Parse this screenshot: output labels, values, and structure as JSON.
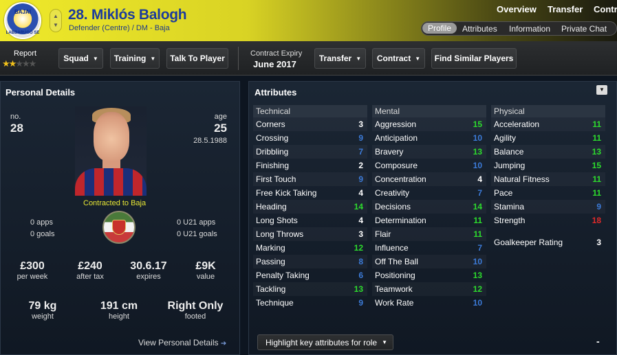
{
  "header": {
    "club_logo_text": [
      "BAJAI",
      "LABDARÚGÓ SE"
    ],
    "player_name": "28. Miklós Balogh",
    "player_role": "Defender (Centre) / DM - Baja",
    "topnav": [
      "Overview",
      "Transfer",
      "Contr"
    ],
    "subnav": [
      "Profile",
      "Attributes",
      "Information",
      "Private Chat"
    ],
    "subnav_active": "Profile"
  },
  "toolbar": {
    "report_label": "Report",
    "report_stars": 2,
    "report_stars_max": 5,
    "squad": "Squad",
    "training": "Training",
    "talk": "Talk To Player",
    "expiry_label": "Contract Expiry",
    "expiry_value": "June 2017",
    "transfer": "Transfer",
    "contract": "Contract",
    "find_similar": "Find Similar Players"
  },
  "personal": {
    "title": "Personal Details",
    "no_label": "no.",
    "no": "28",
    "age_label": "age",
    "age": "25",
    "dob": "28.5.1988",
    "contracted": "Contracted to Baja",
    "apps": "0 apps",
    "goals": "0 goals",
    "u21_apps": "0 U21 apps",
    "u21_goals": "0 U21 goals",
    "wage": "£300",
    "wage_label": "per week",
    "after_tax": "£240",
    "after_tax_label": "after tax",
    "expires": "30.6.17",
    "expires_label": "expires",
    "value": "£9K",
    "value_label": "value",
    "weight": "79 kg",
    "weight_label": "weight",
    "height": "191 cm",
    "height_label": "height",
    "footed": "Right Only",
    "footed_label": "footed",
    "view_link": "View Personal Details"
  },
  "attributes": {
    "title": "Attributes",
    "technical": {
      "label": "Technical",
      "items": [
        {
          "name": "Corners",
          "value": "3",
          "color": "#ffffff"
        },
        {
          "name": "Crossing",
          "value": "9",
          "color": "#3c7bd8"
        },
        {
          "name": "Dribbling",
          "value": "7",
          "color": "#3c7bd8"
        },
        {
          "name": "Finishing",
          "value": "2",
          "color": "#ffffff"
        },
        {
          "name": "First Touch",
          "value": "9",
          "color": "#3c7bd8"
        },
        {
          "name": "Free Kick Taking",
          "value": "4",
          "color": "#ffffff"
        },
        {
          "name": "Heading",
          "value": "14",
          "color": "#2ddc2d"
        },
        {
          "name": "Long Shots",
          "value": "4",
          "color": "#ffffff"
        },
        {
          "name": "Long Throws",
          "value": "3",
          "color": "#ffffff"
        },
        {
          "name": "Marking",
          "value": "12",
          "color": "#2ddc2d"
        },
        {
          "name": "Passing",
          "value": "8",
          "color": "#3c7bd8"
        },
        {
          "name": "Penalty Taking",
          "value": "6",
          "color": "#3c7bd8"
        },
        {
          "name": "Tackling",
          "value": "13",
          "color": "#2ddc2d"
        },
        {
          "name": "Technique",
          "value": "9",
          "color": "#3c7bd8"
        }
      ]
    },
    "mental": {
      "label": "Mental",
      "items": [
        {
          "name": "Aggression",
          "value": "15",
          "color": "#2ddc2d"
        },
        {
          "name": "Anticipation",
          "value": "10",
          "color": "#3c7bd8"
        },
        {
          "name": "Bravery",
          "value": "13",
          "color": "#2ddc2d"
        },
        {
          "name": "Composure",
          "value": "10",
          "color": "#3c7bd8"
        },
        {
          "name": "Concentration",
          "value": "4",
          "color": "#ffffff"
        },
        {
          "name": "Creativity",
          "value": "7",
          "color": "#3c7bd8"
        },
        {
          "name": "Decisions",
          "value": "14",
          "color": "#2ddc2d"
        },
        {
          "name": "Determination",
          "value": "11",
          "color": "#2ddc2d"
        },
        {
          "name": "Flair",
          "value": "11",
          "color": "#2ddc2d"
        },
        {
          "name": "Influence",
          "value": "7",
          "color": "#3c7bd8"
        },
        {
          "name": "Off The Ball",
          "value": "10",
          "color": "#3c7bd8"
        },
        {
          "name": "Positioning",
          "value": "13",
          "color": "#2ddc2d"
        },
        {
          "name": "Teamwork",
          "value": "12",
          "color": "#2ddc2d"
        },
        {
          "name": "Work Rate",
          "value": "10",
          "color": "#3c7bd8"
        }
      ]
    },
    "physical": {
      "label": "Physical",
      "items": [
        {
          "name": "Acceleration",
          "value": "11",
          "color": "#2ddc2d"
        },
        {
          "name": "Agility",
          "value": "11",
          "color": "#2ddc2d"
        },
        {
          "name": "Balance",
          "value": "13",
          "color": "#2ddc2d"
        },
        {
          "name": "Jumping",
          "value": "15",
          "color": "#2ddc2d"
        },
        {
          "name": "Natural Fitness",
          "value": "11",
          "color": "#2ddc2d"
        },
        {
          "name": "Pace",
          "value": "11",
          "color": "#2ddc2d"
        },
        {
          "name": "Stamina",
          "value": "9",
          "color": "#3c7bd8"
        },
        {
          "name": "Strength",
          "value": "18",
          "color": "#e02a2a"
        }
      ],
      "gk_label": "Goalkeeper Rating",
      "gk_value": "3"
    },
    "highlight": "Highlight key attributes for role",
    "minus": "-"
  }
}
